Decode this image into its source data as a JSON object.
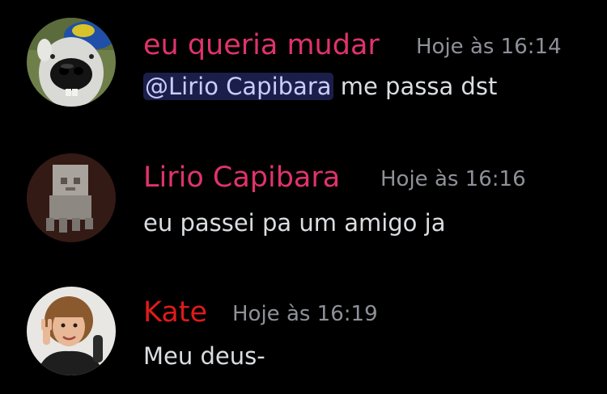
{
  "colors": {
    "background": "#000000",
    "timestamp": "#8f9199",
    "message_text": "#dbdee1",
    "mention_bg": "#2a2f66",
    "mention_text": "#c9cdfb",
    "username_pink": "#e0336b",
    "username_red": "#e11a1a"
  },
  "messages": [
    {
      "avatar": "dog-avatar",
      "username": "eu queria mudar",
      "timestamp": "Hoje às 16:14",
      "mention": "@Lirio Capibara",
      "text": " me passa dst"
    },
    {
      "avatar": "ghost-avatar",
      "username": "Lirio Capibara",
      "timestamp": "Hoje às 16:16",
      "text": "eu passei pa um amigo ja"
    },
    {
      "avatar": "person-avatar",
      "username": "Kate",
      "timestamp": "Hoje às 16:19",
      "text": "Meu deus-"
    }
  ]
}
